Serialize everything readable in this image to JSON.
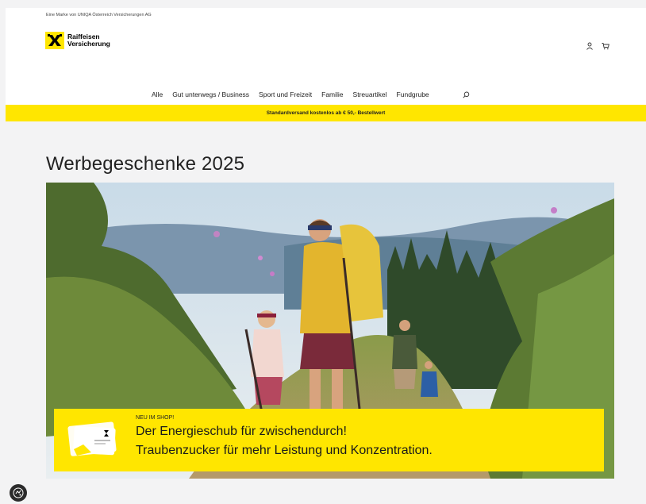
{
  "topbar": {
    "text": "Eine Marke von UNIQA Österreich Versicherungen AG"
  },
  "logo": {
    "line1": "Raiffeisen",
    "line2": "Versicherung"
  },
  "header": {
    "icons": [
      "user-icon",
      "cart-icon"
    ]
  },
  "nav": {
    "items": [
      {
        "label": "Alle"
      },
      {
        "label": "Gut unterwegs / Business"
      },
      {
        "label": "Sport und Freizeit"
      },
      {
        "label": "Familie"
      },
      {
        "label": "Streuartikel"
      },
      {
        "label": "Fundgrube"
      }
    ],
    "search_icon": "search-icon"
  },
  "promo": {
    "text": "Standardversand kostenlos ab € 50,- Bestellwert"
  },
  "main": {
    "title": "Werbegeschenke 2025"
  },
  "hero": {
    "kicker": "NEU IM SHOP!",
    "line1": "Der Energieschub für zwischendurch!",
    "line2": "Traubenzucker für mehr Leistung und Konzentration."
  },
  "colors": {
    "brand_yellow": "#ffe600",
    "page_bg": "#f3f3f4"
  }
}
